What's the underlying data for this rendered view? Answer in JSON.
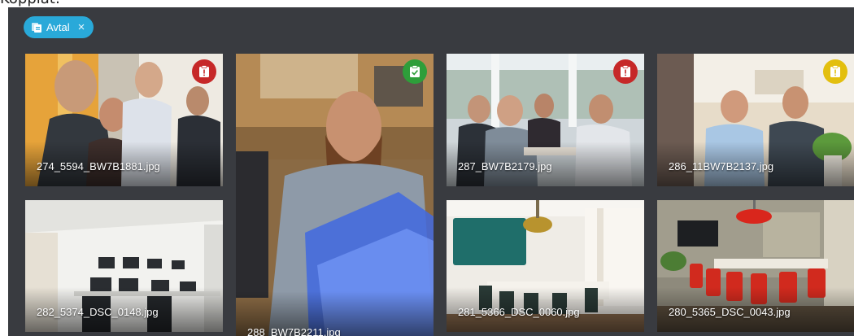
{
  "page": {
    "partial_heading": "Kopplat:"
  },
  "filter_chip": {
    "label": "Avtal",
    "close_symbol": "×",
    "color": "#29a9d9"
  },
  "status_colors": {
    "red": "#c62828",
    "green": "#2e9e3a",
    "yellow": "#e3bf0e"
  },
  "images": [
    {
      "filename": "274_5594_BW7B1881.jpg",
      "status": "red",
      "status_icon": "clipboard-alert-icon"
    },
    {
      "filename": "288_BW7B2211.jpg",
      "status": "green",
      "status_icon": "clipboard-check-icon"
    },
    {
      "filename": "287_BW7B2179.jpg",
      "status": "red",
      "status_icon": "clipboard-alert-icon"
    },
    {
      "filename": "286_11BW7B2137.jpg",
      "status": "yellow",
      "status_icon": "clipboard-alert-icon"
    },
    {
      "filename": "282_5374_DSC_0148.jpg",
      "status": "none"
    },
    {
      "filename": "281_5366_DSC_0060.jpg",
      "status": "none"
    },
    {
      "filename": "280_5365_DSC_0043.jpg",
      "status": "none"
    }
  ]
}
